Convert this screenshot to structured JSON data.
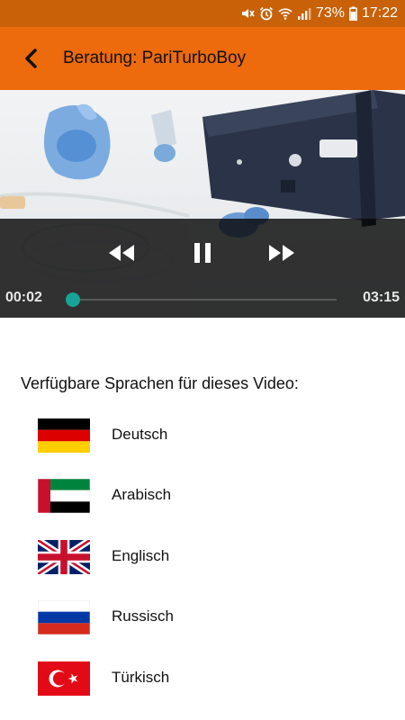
{
  "status": {
    "battery": "73%",
    "time": "17:22",
    "icons": [
      "mute-icon",
      "alarm-icon",
      "wifi-icon",
      "signal-icon",
      "battery-icon"
    ]
  },
  "appbar": {
    "title": "Beratung: PariTurboBoy",
    "back_icon": "arrow-back-icon",
    "color": "#ed6b0c"
  },
  "player": {
    "current_time": "00:02",
    "duration": "03:15",
    "progress": 0.01,
    "state": "playing",
    "accent": "#17a398",
    "controls": [
      "rewind",
      "pause",
      "fast-forward"
    ]
  },
  "languages": {
    "heading": "Verfügbare Sprachen für dieses Video:",
    "items": [
      {
        "label": "Deutsch",
        "flag": "germany-flag-icon"
      },
      {
        "label": "Arabisch",
        "flag": "uae-flag-icon"
      },
      {
        "label": "Englisch",
        "flag": "uk-flag-icon"
      },
      {
        "label": "Russisch",
        "flag": "russia-flag-icon"
      },
      {
        "label": "Türkisch",
        "flag": "turkey-flag-icon"
      }
    ]
  }
}
